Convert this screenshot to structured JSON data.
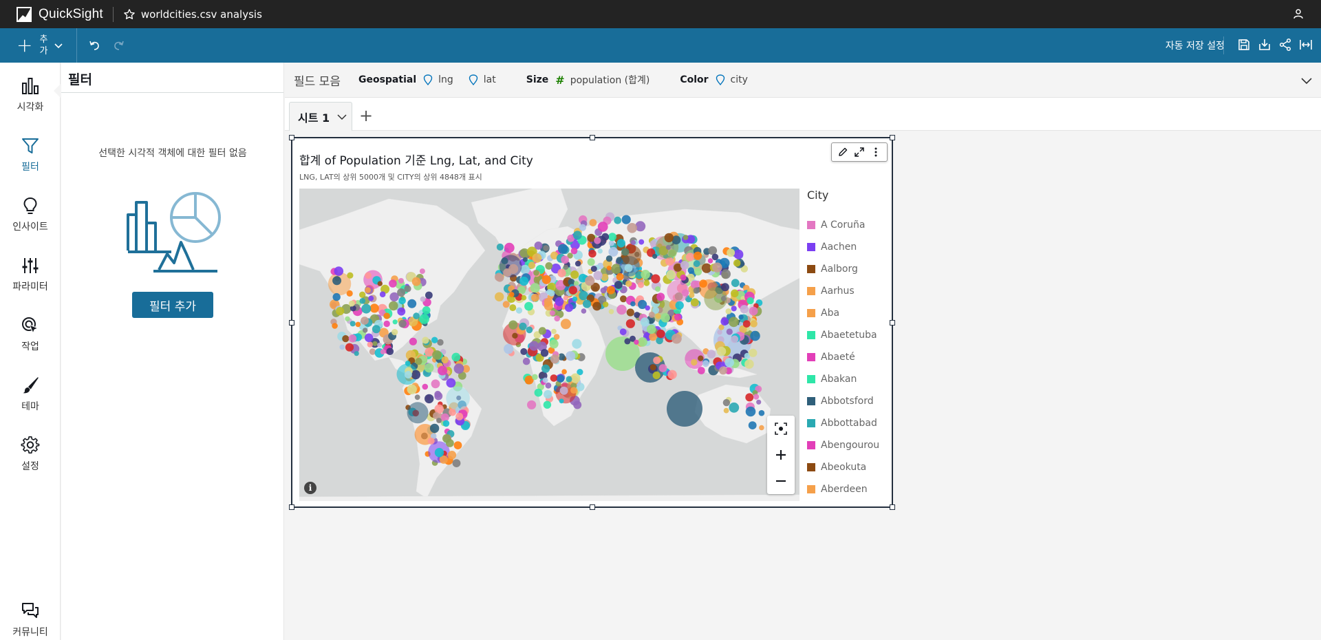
{
  "app": {
    "logo_text": "QuickSight",
    "analysis_name": "worldcities.csv analysis"
  },
  "toolbar": {
    "add_label": "추가",
    "autosave_label": "자동 저장 설정"
  },
  "leftnav": {
    "items": [
      {
        "label": "시각화",
        "icon": "bar-chart-icon"
      },
      {
        "label": "필터",
        "icon": "filter-icon",
        "active": true
      },
      {
        "label": "인사이트",
        "icon": "lightbulb-icon"
      },
      {
        "label": "파라미터",
        "icon": "sliders-icon"
      },
      {
        "label": "작업",
        "icon": "cursor-click-icon"
      },
      {
        "label": "테마",
        "icon": "brush-icon"
      },
      {
        "label": "설정",
        "icon": "gear-icon"
      }
    ],
    "community_label": "커뮤니티"
  },
  "filter_panel": {
    "title": "필터",
    "empty_message": "선택한 시각적 객체에 대한 필터 없음",
    "add_filter_label": "필터 추가"
  },
  "field_well": {
    "title": "필드 모음",
    "geospatial_label": "Geospatial",
    "geospatial_fields": [
      "lng",
      "lat"
    ],
    "size_label": "Size",
    "size_field": "population (합계)",
    "color_label": "Color",
    "color_field": "city"
  },
  "sheets": {
    "tabs": [
      "시트 1"
    ]
  },
  "visual": {
    "title": "합계 of Population 기준 Lng, Lat, and City",
    "subtitle": "LNG, LAT의 상위 5000개 및 CITY의 상위 4848개 표시",
    "type": "geospatial point map",
    "legend": {
      "title": "City",
      "items": [
        {
          "label": "A Coruña",
          "color": "#e377c2"
        },
        {
          "label": "Aachen",
          "color": "#7b3ff2"
        },
        {
          "label": "Aalborg",
          "color": "#8c4a12"
        },
        {
          "label": "Aarhus",
          "color": "#f5a04a"
        },
        {
          "label": "Aba",
          "color": "#f5a04a"
        },
        {
          "label": "Abaetetuba",
          "color": "#2ee6a8"
        },
        {
          "label": "Abaeté",
          "color": "#e23fb8"
        },
        {
          "label": "Abakan",
          "color": "#2ee6a8"
        },
        {
          "label": "Abbotsford",
          "color": "#2f5f7a"
        },
        {
          "label": "Abbottabad",
          "color": "#2aa9b2"
        },
        {
          "label": "Abengourou",
          "color": "#e23fb8"
        },
        {
          "label": "Abeokuta",
          "color": "#8c4a12"
        },
        {
          "label": "Aberdeen",
          "color": "#f5a04a"
        }
      ]
    },
    "palette": [
      "#e377c2",
      "#7b3ff2",
      "#8c4a12",
      "#f5a04a",
      "#2ee6a8",
      "#e23fb8",
      "#2f5f7a",
      "#2aa9b2",
      "#1f77b4",
      "#98df8a",
      "#ff7f0e",
      "#d62728",
      "#9467bd",
      "#bcbd22",
      "#17becf",
      "#c5b0d5",
      "#aec7e8",
      "#ff9896",
      "#c49c94",
      "#7f7f7f",
      "#dbdb8d",
      "#9edae5",
      "#8ca252",
      "#e7ba52",
      "#393b79"
    ]
  }
}
